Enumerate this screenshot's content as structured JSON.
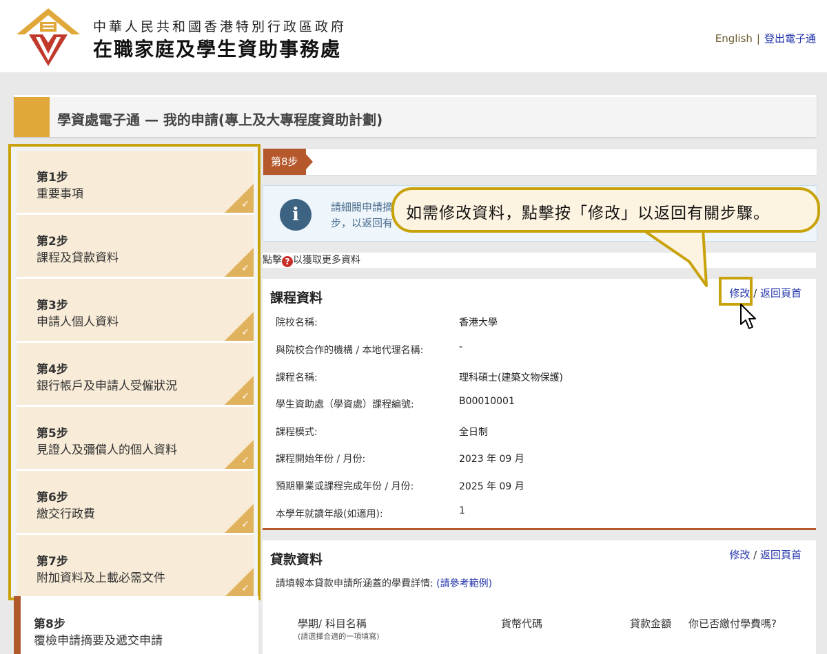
{
  "header": {
    "gov_name": "中華人民共和國香港特別行政區政府",
    "dept_name": "在職家庭及學生資助事務處",
    "lang_link": "English",
    "separator": "|",
    "logout_link": "登出電子通"
  },
  "page_title": "學資處電子通 — 我的申請(專上及大專程度資助計劃)",
  "sidebar": {
    "steps": [
      {
        "num": "第1步",
        "name": "重要事項"
      },
      {
        "num": "第2步",
        "name": "課程及貸款資料"
      },
      {
        "num": "第3步",
        "name": "申請人個人資料"
      },
      {
        "num": "第4步",
        "name": "銀行帳戶及申請人受僱狀況"
      },
      {
        "num": "第5步",
        "name": "見證人及彌償人的個人資料"
      },
      {
        "num": "第6步",
        "name": "繳交行政費"
      },
      {
        "num": "第7步",
        "name": "附加資料及上載必需文件"
      },
      {
        "num": "第8步",
        "name": "覆檢申請摘要及遞交申請"
      }
    ],
    "check": "✓"
  },
  "step_tag": "第8步",
  "info": {
    "line1": "請細閱申請摘",
    "line2": "步，以返回有"
  },
  "help": {
    "prefix": "點擊",
    "icon": "?",
    "suffix": "以獲取更多資料"
  },
  "course": {
    "title": "課程資料",
    "edit": "修改",
    "sep": "/",
    "back": "返回頁首",
    "rows": [
      {
        "label": "院校名稱:",
        "value": "香港大學"
      },
      {
        "label": "與院校合作的機構 / 本地代理名稱:",
        "value": "-"
      },
      {
        "label": "課程名稱:",
        "value": "理科碩士(建築文物保護)"
      },
      {
        "label": "學生資助處（學資處）課程編號:",
        "value": "B00010001"
      },
      {
        "label": "課程模式:",
        "value": "全日制"
      },
      {
        "label": "課程開始年份 / 月份:",
        "value": "2023 年 09 月"
      },
      {
        "label": "預期畢業或課程完成年份 / 月份:",
        "value": "2025 年 09 月"
      },
      {
        "label": "本學年就讀年級(如適用):",
        "value": "1"
      }
    ]
  },
  "loan": {
    "title": "貸款資料",
    "edit": "修改",
    "sep": "/",
    "back": "返回頁首",
    "intro": "請填報本貸款申請所涵蓋的學費詳情:",
    "example_link": "(請參考範例)",
    "columns": [
      "學期/ 科目名稱",
      "貨幣代碼",
      "貸款金額",
      "你已否繳付學費嗎?"
    ],
    "column_note": "(請選擇合適的一項填寫)"
  },
  "callout": "如需修改資料，點擊按「修改」以返回有關步驟。",
  "colors": {
    "accent_gold": "#c8a20a",
    "step_tag": "#b5582b",
    "logo_orange": "#e0a83a",
    "logo_red": "#c0392b"
  }
}
